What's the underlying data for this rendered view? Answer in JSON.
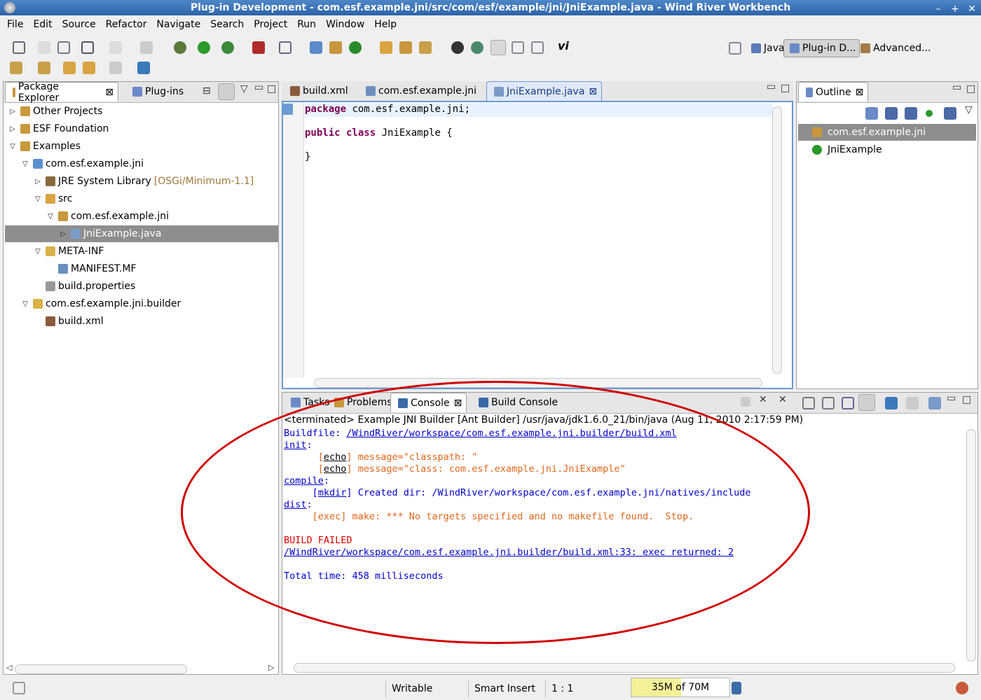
{
  "window": {
    "title": "Plug-in Development - com.esf.example.jni/src/com/esf/example/jni/JniExample.java - Wind River Workbench"
  },
  "menu": [
    "File",
    "Edit",
    "Source",
    "Refactor",
    "Navigate",
    "Search",
    "Project",
    "Run",
    "Window",
    "Help"
  ],
  "perspectives": [
    {
      "label": "Java",
      "active": false
    },
    {
      "label": "Plug-in D...",
      "active": true
    },
    {
      "label": "Advanced...",
      "active": false
    }
  ],
  "left_panel": {
    "tabs": [
      {
        "label": "Package Explorer",
        "active": true
      },
      {
        "label": "Plug-ins",
        "active": false
      }
    ],
    "tree": [
      {
        "label": "Other Projects",
        "depth": 0,
        "expanded": false,
        "icon": "project-icon",
        "color": "#c89a3c"
      },
      {
        "label": "ESF Foundation",
        "depth": 0,
        "expanded": false,
        "icon": "project-icon",
        "color": "#c89a3c"
      },
      {
        "label": "Examples",
        "depth": 0,
        "expanded": true,
        "icon": "working-set-icon",
        "color": "#c89a3c"
      },
      {
        "label": "com.esf.example.jni",
        "depth": 1,
        "expanded": true,
        "icon": "plugin-project-icon",
        "color": "#5b8fd0"
      },
      {
        "label": "JRE System Library",
        "suffix": "[OSGi/Minimum-1.1]",
        "depth": 2,
        "expanded": false,
        "icon": "library-icon",
        "color": "#8a6a3c"
      },
      {
        "label": "src",
        "depth": 2,
        "expanded": true,
        "icon": "source-folder-icon",
        "color": "#d9a441"
      },
      {
        "label": "com.esf.example.jni",
        "depth": 3,
        "expanded": true,
        "icon": "package-icon",
        "color": "#c8963c"
      },
      {
        "label": "JniExample.java",
        "depth": 4,
        "expanded": false,
        "icon": "java-file-icon",
        "color": "#7a9ac8",
        "selected": true
      },
      {
        "label": "META-INF",
        "depth": 2,
        "expanded": true,
        "icon": "folder-icon",
        "color": "#d9b24a"
      },
      {
        "label": "MANIFEST.MF",
        "depth": 3,
        "icon": "manifest-icon",
        "color": "#6b8fbf"
      },
      {
        "label": "build.properties",
        "depth": 2,
        "icon": "properties-icon",
        "color": "#999"
      },
      {
        "label": "com.esf.example.jni.builder",
        "depth": 1,
        "expanded": true,
        "icon": "project-icon",
        "color": "#d9b24a"
      },
      {
        "label": "build.xml",
        "depth": 2,
        "icon": "ant-file-icon",
        "color": "#8a5a3c"
      }
    ]
  },
  "editor": {
    "tabs": [
      {
        "label": "build.xml",
        "active": false
      },
      {
        "label": "com.esf.example.jni",
        "active": false
      },
      {
        "label": "JniExample.java",
        "active": true
      }
    ],
    "code": {
      "line1_kw": "package",
      "line1_rest": " com.esf.example.jni;",
      "line2_kw": "public class",
      "line2_rest": " JniExample {",
      "line3": "}"
    }
  },
  "outline": {
    "tab": "Outline",
    "items": [
      {
        "label": "com.esf.example.jni",
        "icon": "package-icon",
        "selected": true
      },
      {
        "label": "JniExample",
        "icon": "class-icon",
        "selected": false
      }
    ]
  },
  "console_panel": {
    "tabs": [
      {
        "label": "Tasks",
        "active": false
      },
      {
        "label": "Problems",
        "active": false
      },
      {
        "label": "Console",
        "active": true
      },
      {
        "label": "Build Console",
        "active": false
      }
    ],
    "header": "<terminated> Example JNI Builder [Ant Builder] /usr/java/jdk1.6.0_21/bin/java (Aug 11, 2010 2:17:59 PM)",
    "lines": {
      "buildfile_label": "Buildfile: ",
      "buildfile_path": "/WindRiver/workspace/com.esf.example.jni.builder/build.xml",
      "init": "init",
      "echo1_tag": "echo",
      "echo1_msg": " message=\"classpath: \"",
      "echo2_tag": "echo",
      "echo2_msg": " message=\"class: com.esf.example.jni.JniExample\"",
      "compile": "compile",
      "mkdir_tag": "mkdir",
      "mkdir_msg": " Created dir: /WindRiver/workspace/com.esf.example.jni/natives/include",
      "dist": "dist",
      "exec_line": "     [exec] make: *** No targets specified and no makefile found.  Stop.",
      "build_failed": "BUILD FAILED",
      "fail_link": "/WindRiver/workspace/com.esf.example.jni.builder/build.xml:33: exec returned: 2",
      "total_time": "Total time: 458 milliseconds"
    },
    "colors": {
      "link": "#0000c8",
      "echo": "#e0661a",
      "error": "#d00000"
    }
  },
  "status_bar": {
    "writable": "Writable",
    "insert_mode": "Smart Insert",
    "position": "1 : 1",
    "memory": "35M of 70M"
  },
  "annotation": {
    "color": "#d10000",
    "shape": "ellipse"
  }
}
